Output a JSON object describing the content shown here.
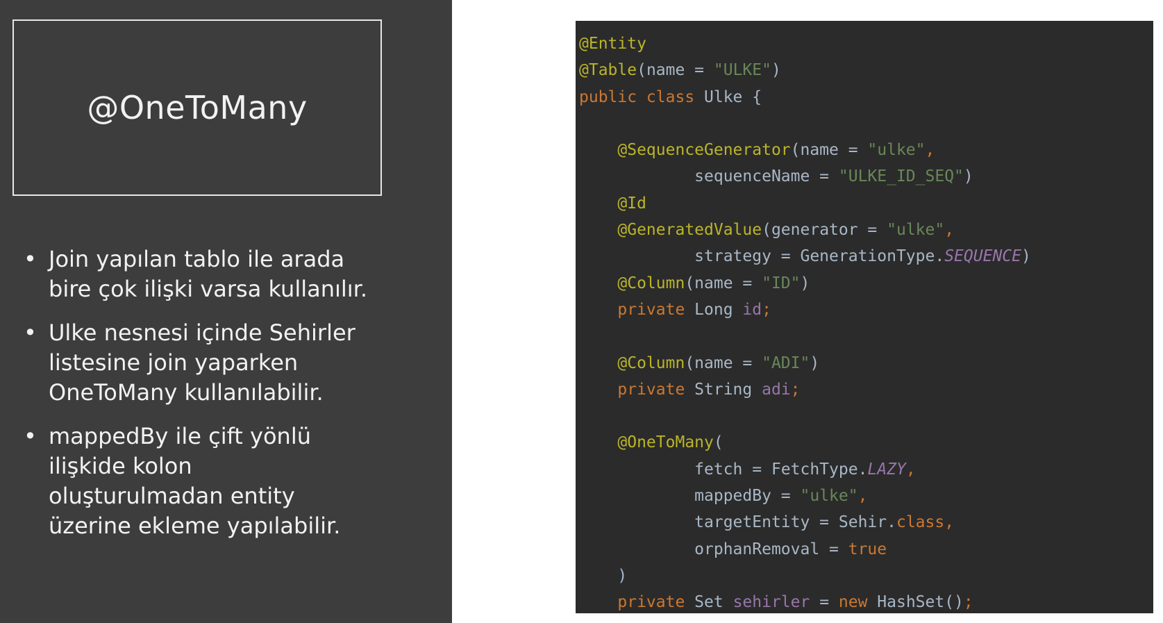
{
  "slide": {
    "title": "@OneToMany",
    "bullets": [
      [
        "Join yapılan tablo ile arada",
        "bire çok ilişki varsa kullanılır."
      ],
      [
        "Ulke nesnesi içinde Sehirler",
        "listesine join yaparken",
        "OneToMany kullanılabilir."
      ],
      [
        "mappedBy ile çift yönlü",
        "ilişkide kolon",
        "oluşturulmadan entity",
        "üzerine ekleme yapılabilir."
      ]
    ],
    "bullet_symbol": "•"
  },
  "colors": {
    "left_background": "#3d3d3d",
    "code_background": "#2b2b2b",
    "annotation": "#bbb529",
    "keyword": "#cc7832",
    "string": "#6a8759",
    "field": "#9876aa",
    "plain": "#a9b7c6"
  },
  "code_lines": [
    [
      [
        "ann",
        "@Entity"
      ]
    ],
    [
      [
        "ann",
        "@Table"
      ],
      [
        "plain",
        "(name = "
      ],
      [
        "str",
        "\"ULKE\""
      ],
      [
        "plain",
        ")"
      ]
    ],
    [
      [
        "kw",
        "public class "
      ],
      [
        "plain",
        "Ulke {"
      ]
    ],
    [
      [
        "plain",
        ""
      ]
    ],
    [
      [
        "plain",
        "    "
      ],
      [
        "ann",
        "@SequenceGenerator"
      ],
      [
        "plain",
        "(name = "
      ],
      [
        "str",
        "\"ulke\""
      ],
      [
        "kw",
        ","
      ]
    ],
    [
      [
        "plain",
        "            sequenceName = "
      ],
      [
        "str",
        "\"ULKE_ID_SEQ\""
      ],
      [
        "plain",
        ")"
      ]
    ],
    [
      [
        "plain",
        "    "
      ],
      [
        "ann",
        "@Id"
      ]
    ],
    [
      [
        "plain",
        "    "
      ],
      [
        "ann",
        "@GeneratedValue"
      ],
      [
        "plain",
        "(generator = "
      ],
      [
        "str",
        "\"ulke\""
      ],
      [
        "kw",
        ","
      ]
    ],
    [
      [
        "plain",
        "            strategy = GenerationType."
      ],
      [
        "ital",
        "SEQUENCE"
      ],
      [
        "plain",
        ")"
      ]
    ],
    [
      [
        "plain",
        "    "
      ],
      [
        "ann",
        "@Column"
      ],
      [
        "plain",
        "(name = "
      ],
      [
        "str",
        "\"ID\""
      ],
      [
        "plain",
        ")"
      ]
    ],
    [
      [
        "plain",
        "    "
      ],
      [
        "kw",
        "private "
      ],
      [
        "plain",
        "Long "
      ],
      [
        "fld",
        "id"
      ],
      [
        "kw",
        ";"
      ]
    ],
    [
      [
        "plain",
        ""
      ]
    ],
    [
      [
        "plain",
        "    "
      ],
      [
        "ann",
        "@Column"
      ],
      [
        "plain",
        "(name = "
      ],
      [
        "str",
        "\"ADI\""
      ],
      [
        "plain",
        ")"
      ]
    ],
    [
      [
        "plain",
        "    "
      ],
      [
        "kw",
        "private "
      ],
      [
        "plain",
        "String "
      ],
      [
        "fld",
        "adi"
      ],
      [
        "kw",
        ";"
      ]
    ],
    [
      [
        "plain",
        ""
      ]
    ],
    [
      [
        "plain",
        "    "
      ],
      [
        "ann",
        "@OneToMany"
      ],
      [
        "plain",
        "("
      ]
    ],
    [
      [
        "plain",
        "            fetch = FetchType."
      ],
      [
        "ital",
        "LAZY"
      ],
      [
        "kw",
        ","
      ]
    ],
    [
      [
        "plain",
        "            mappedBy = "
      ],
      [
        "str",
        "\"ulke\""
      ],
      [
        "kw",
        ","
      ]
    ],
    [
      [
        "plain",
        "            targetEntity = Sehir."
      ],
      [
        "kw",
        "class,"
      ]
    ],
    [
      [
        "plain",
        "            orphanRemoval = "
      ],
      [
        "kw",
        "true"
      ]
    ],
    [
      [
        "plain",
        "    )"
      ]
    ],
    [
      [
        "plain",
        "    "
      ],
      [
        "kw",
        "private "
      ],
      [
        "plain",
        "Set "
      ],
      [
        "fld",
        "sehirler"
      ],
      [
        "plain",
        " = "
      ],
      [
        "kw",
        "new "
      ],
      [
        "plain",
        "HashSet()"
      ],
      [
        "kw",
        ";"
      ]
    ]
  ]
}
